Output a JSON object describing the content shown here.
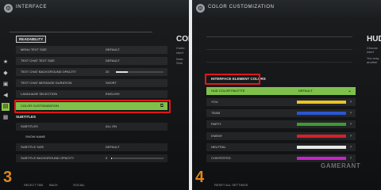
{
  "panel3": {
    "title": "INTERFACE",
    "section": "READABILITY",
    "right_heading": "COL",
    "right_lines": [
      "Custo",
      "interf",
      "Note: Sele"
    ],
    "rows": [
      {
        "label": "MENU TEXT SIZE",
        "value": "DEFAULT"
      },
      {
        "label": "TEXT CHAT TEXT SIZE",
        "value": "DEFAULT"
      },
      {
        "label": "TEXT CHAT BACKGROUND OPACITY",
        "value": "20"
      },
      {
        "label": "TEXT CHAT MESSAGE DURATION",
        "value": "SHORT"
      },
      {
        "label": "LANGUAGE SELECTION",
        "value": "ENGLISH"
      },
      {
        "label": "COLOR CUSTOMIZATION",
        "value": ""
      }
    ],
    "subtitles_head": "SUBTITLES",
    "rows2": [
      {
        "label": "SUBTITLES",
        "value": "ALL ON"
      },
      {
        "label": "SHOW NAME",
        "value": ""
      },
      {
        "label": "SUBTITLE SIZE",
        "value": "DEFAULT"
      },
      {
        "label": "SUBTITLE BACKGROUND OPACITY",
        "value": "0"
      }
    ],
    "slider_fill": {
      "chat_opacity": 0.25,
      "subtitle_opacity": 0.02
    },
    "bottom": [
      "SELECT TAB",
      "BACK",
      "SOCIAL"
    ],
    "step": "3"
  },
  "panel4": {
    "title": "COLOR CUSTOMIZATION",
    "section": "INTERFACE ELEMENT COLORS",
    "right_heading": "HUD",
    "right_lines": [
      "Choose",
      "interf",
      "You may",
      "another"
    ],
    "palette": {
      "label": "HUD COLOR PALETTE",
      "value": "DEFAULT"
    },
    "colors": [
      {
        "label": "YOU",
        "color": "#e9c328"
      },
      {
        "label": "TEAM",
        "color": "#2b56d0"
      },
      {
        "label": "PARTY",
        "color": "#3f9b2f"
      },
      {
        "label": "ENEMY",
        "color": "#d4212b"
      },
      {
        "label": "NEUTRAL",
        "color": "#e8e8e8"
      },
      {
        "label": "CONTESTED",
        "color": "#c823c8"
      }
    ],
    "bottom": "RESET ALL SETTINGS",
    "watermark": "GAMERANT",
    "step": "4"
  },
  "accent": "#7fc04a",
  "highlight": "#e01818",
  "step_color": "#e0851e"
}
